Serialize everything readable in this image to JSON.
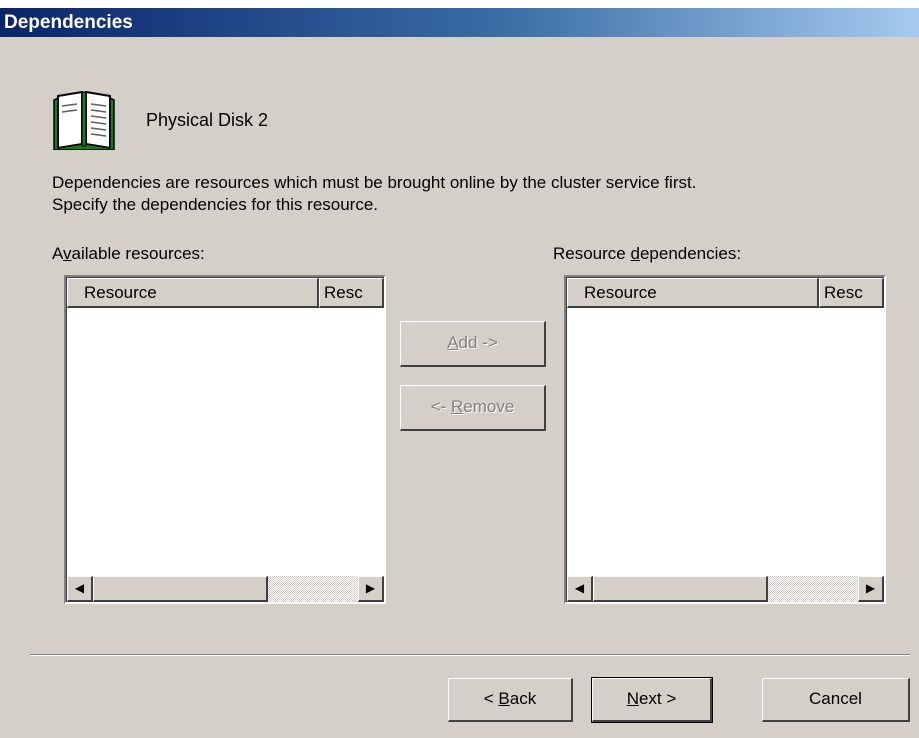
{
  "window": {
    "title": "Dependencies"
  },
  "resource": {
    "name": "Physical Disk 2",
    "icon": "book-icon"
  },
  "description": {
    "line1": "Dependencies are resources which must be brought online by the cluster service first.",
    "line2": "Specify the dependencies for this resource."
  },
  "available": {
    "label_pre": "A",
    "label_u": "v",
    "label_post": "ailable resources:",
    "columns": [
      "Resource",
      "Resc"
    ],
    "rows": []
  },
  "dependencies": {
    "label_pre": "Resource ",
    "label_u": "d",
    "label_post": "ependencies:",
    "columns": [
      "Resource",
      "Resc"
    ],
    "rows": []
  },
  "actions": {
    "add": {
      "u": "A",
      "rest": "dd ->",
      "enabled": false
    },
    "remove": {
      "pre": "<- ",
      "u": "R",
      "rest": "emove",
      "enabled": false
    }
  },
  "footer": {
    "back": {
      "pre": "< ",
      "u": "B",
      "rest": "ack"
    },
    "next": {
      "u": "N",
      "rest": "ext >"
    },
    "cancel": "Cancel"
  },
  "colors": {
    "title_start": "#0a246a",
    "title_end": "#a6caf0",
    "face": "#d4d0c8"
  }
}
